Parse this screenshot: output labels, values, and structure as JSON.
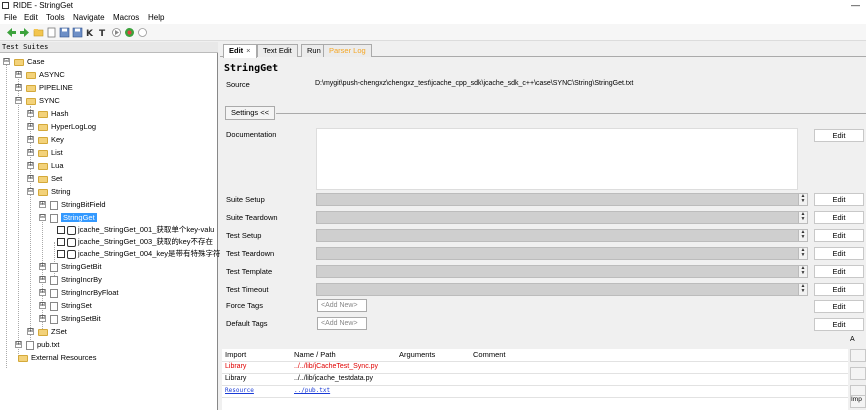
{
  "window": {
    "title": "RIDE - StringGet",
    "minimize_glyph": "—"
  },
  "menu": [
    "File",
    "Edit",
    "Tools",
    "Navigate",
    "Macros",
    "Help"
  ],
  "toolbar": {
    "buttons": [
      "back-arrow-icon",
      "forward-arrow-icon",
      "open-folder-icon",
      "new-file-icon",
      "save-icon",
      "save-all-icon",
      "keyword-icon",
      "test-icon",
      "run-icon",
      "stop-icon",
      "search-icon"
    ],
    "colors": {
      "green_arrow": "#3ca23c",
      "folder": "#f3c54e"
    }
  },
  "tree": {
    "header": "Test Suites",
    "selected_color": "#3399ff",
    "nodes": [
      {
        "label": "Case",
        "kind": "folder",
        "expander": "⊟"
      },
      {
        "label": "ASYNC",
        "kind": "folder",
        "expander": "⊞"
      },
      {
        "label": "PIPELINE",
        "kind": "folder",
        "expander": "⊞"
      },
      {
        "label": "SYNC",
        "kind": "folder",
        "expander": "⊟"
      },
      {
        "label": "Hash",
        "kind": "folder",
        "expander": "⊞"
      },
      {
        "label": "HyperLogLog",
        "kind": "folder",
        "expander": "⊞"
      },
      {
        "label": "Key",
        "kind": "folder",
        "expander": "⊞"
      },
      {
        "label": "List",
        "kind": "folder",
        "expander": "⊞"
      },
      {
        "label": "Lua",
        "kind": "folder",
        "expander": "⊞"
      },
      {
        "label": "Set",
        "kind": "folder",
        "expander": "⊞"
      },
      {
        "label": "String",
        "kind": "folder",
        "expander": "⊟"
      },
      {
        "label": "StringBitField",
        "kind": "file",
        "expander": "⊞"
      },
      {
        "label": "StringGet",
        "kind": "file",
        "expander": "⊟",
        "selected": true
      },
      {
        "label": "jcache_StringGet_001_获取单个key-valu",
        "kind": "test"
      },
      {
        "label": "jcache_StringGet_003_获取的key不存在",
        "kind": "test"
      },
      {
        "label": "jcache_StringGet_004_key是带有特殊字符",
        "kind": "test"
      },
      {
        "label": "StringGetBit",
        "kind": "file",
        "expander": "⊞"
      },
      {
        "label": "StringIncrBy",
        "kind": "file",
        "expander": "⊞"
      },
      {
        "label": "StringIncrByFloat",
        "kind": "file",
        "expander": "⊞"
      },
      {
        "label": "StringSet",
        "kind": "file",
        "expander": "⊞"
      },
      {
        "label": "StringSetBit",
        "kind": "file",
        "expander": "⊞"
      },
      {
        "label": "ZSet",
        "kind": "folder",
        "expander": "⊞"
      },
      {
        "label": "pub.txt",
        "kind": "file",
        "expander": "⊞"
      },
      {
        "label": "External Resources",
        "kind": "folder"
      }
    ]
  },
  "tabs": [
    {
      "label": "Edit",
      "active": true,
      "close": "×"
    },
    {
      "label": "Text Edit"
    },
    {
      "label": "Run"
    },
    {
      "label": "Parser Log",
      "color": "#f5a623"
    }
  ],
  "editor": {
    "suite_name": "StringGet",
    "source_label": "Source",
    "source_value": "D:\\mygit\\push-chengxz\\chengxz_test\\jcache_cpp_sdk\\jcache_sdk_c++\\case\\SYNC\\String\\StringGet.txt",
    "settings_button": "Settings <<",
    "documentation_label": "Documentation",
    "edit_label": "Edit",
    "spin_up": "▲",
    "spin_down": "▼",
    "settings": [
      {
        "label": "Suite Setup"
      },
      {
        "label": "Suite Teardown"
      },
      {
        "label": "Test Setup"
      },
      {
        "label": "Test Teardown"
      },
      {
        "label": "Test Template"
      },
      {
        "label": "Test Timeout"
      }
    ],
    "force_tags_label": "Force Tags",
    "default_tags_label": "Default Tags",
    "add_new": "<Add New>"
  },
  "imports": {
    "headers": [
      "Import",
      "Name / Path",
      "Arguments",
      "Comment"
    ],
    "rows": [
      {
        "type": "Library",
        "path": "../../lib/jCacheTest_Sync.py",
        "color": "#e00000"
      },
      {
        "type": "Library",
        "path": "../../lib/jcache_testdata.py",
        "color": "#000000"
      },
      {
        "type": "Resource",
        "path": "../pub.txt",
        "color": "#1a3bd6"
      }
    ],
    "side_buttons": [
      "A",
      "",
      "",
      "",
      "Imp"
    ]
  }
}
